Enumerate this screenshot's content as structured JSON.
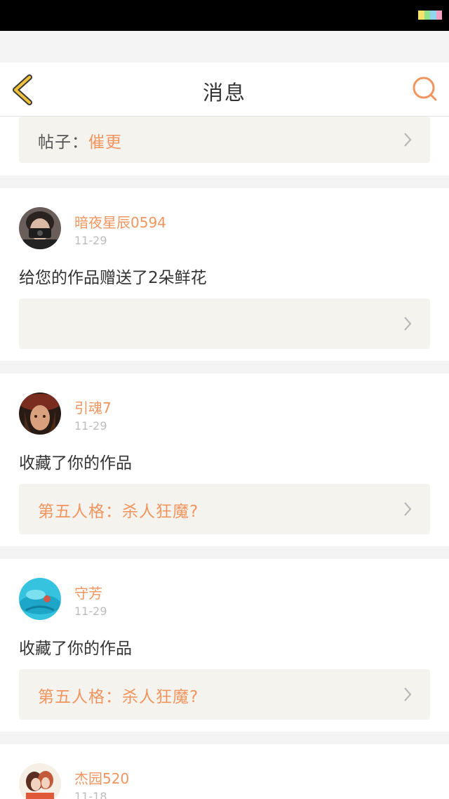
{
  "header": {
    "title": "消息"
  },
  "top_card": {
    "post_prefix": "帖子：",
    "post_title": "催更"
  },
  "messages": [
    {
      "username": "暗夜星辰0594",
      "time": "11-29",
      "text": "给您的作品赠送了2朵鲜花",
      "work_title": ""
    },
    {
      "username": "引魂7",
      "time": "11-29",
      "text": "收藏了你的作品",
      "work_title": "第五人格：杀人狂魔?"
    },
    {
      "username": "守芳",
      "time": "11-29",
      "text": "收藏了你的作品",
      "work_title": "第五人格：杀人狂魔?"
    },
    {
      "username": "杰园520",
      "time": "11-18",
      "text": "",
      "work_title": ""
    }
  ],
  "colors": {
    "accent": "#f0955f",
    "back_icon": "#f3c23a",
    "link_bg": "#f4f3ee",
    "page_bg": "#f4f4f4"
  }
}
